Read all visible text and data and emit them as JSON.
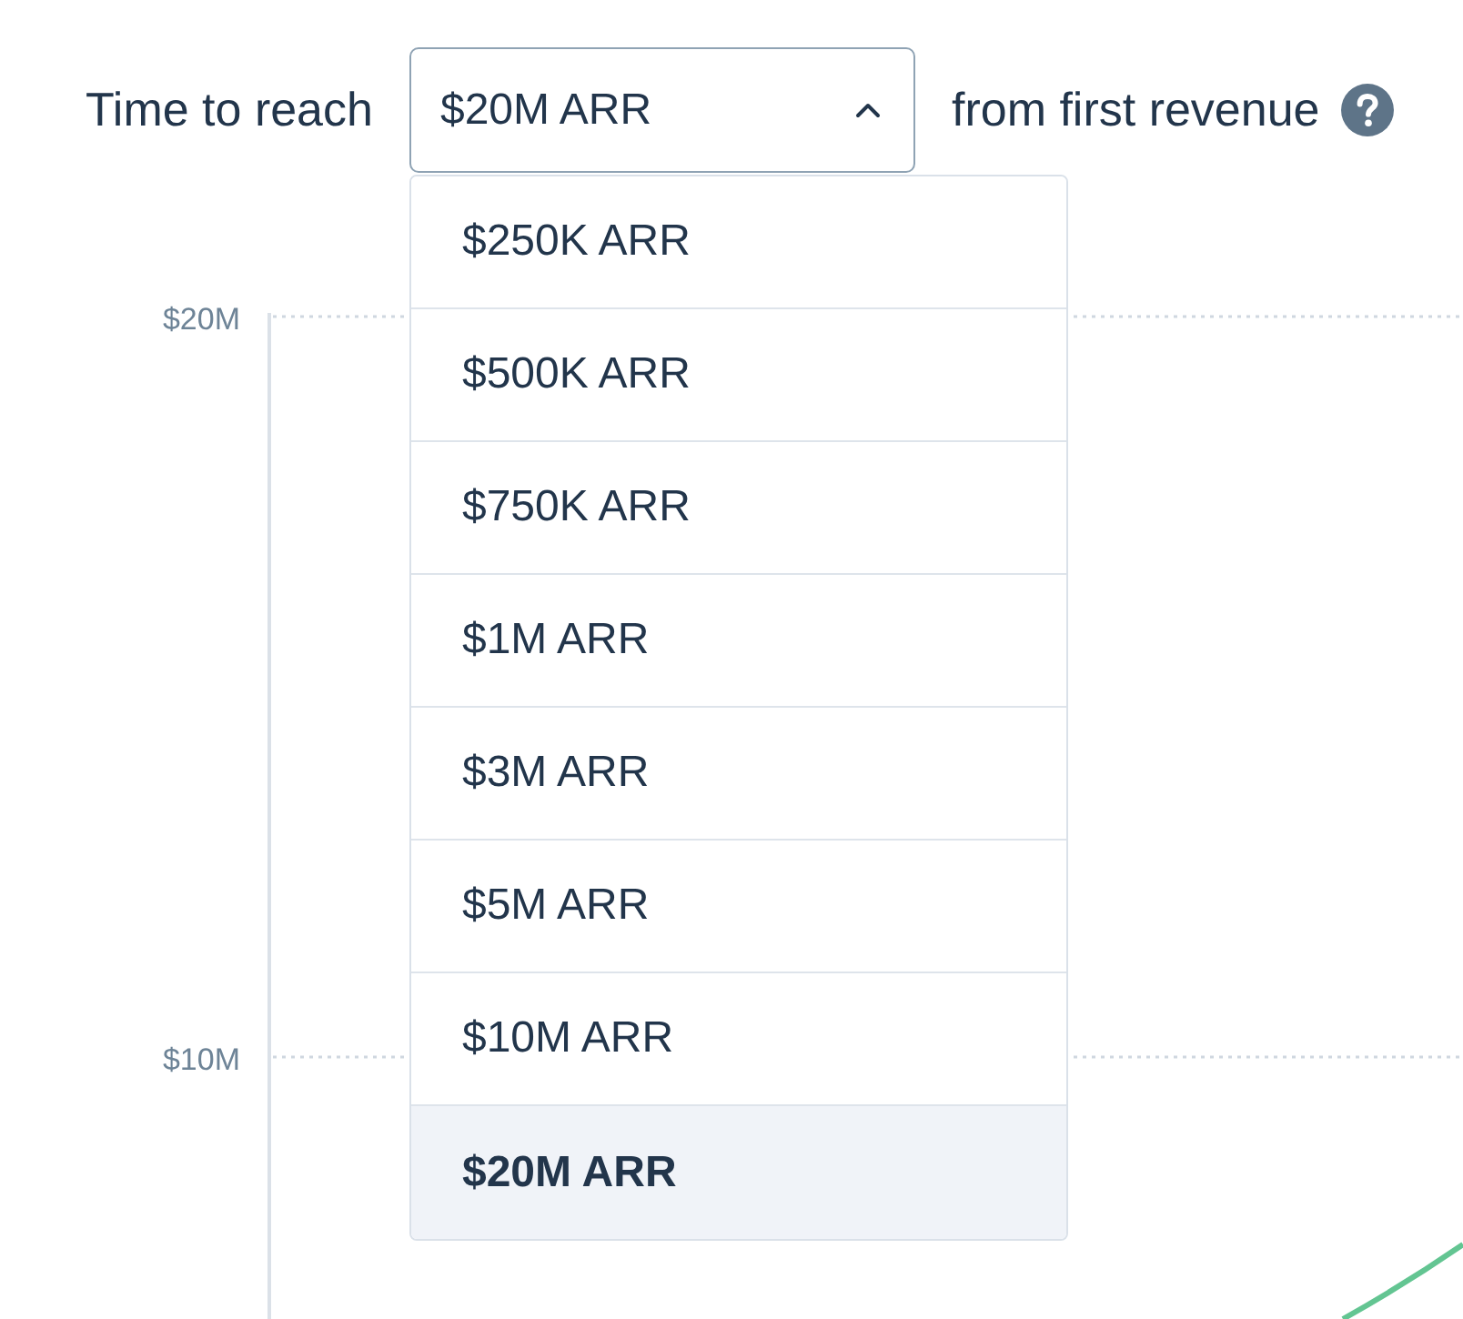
{
  "filter": {
    "prefix": "Time to reach",
    "select": {
      "value": "$20M ARR",
      "expanded": true,
      "options": [
        {
          "label": "$250K ARR",
          "selected": false
        },
        {
          "label": "$500K ARR",
          "selected": false
        },
        {
          "label": "$750K ARR",
          "selected": false
        },
        {
          "label": "$1M ARR",
          "selected": false
        },
        {
          "label": "$3M ARR",
          "selected": false
        },
        {
          "label": "$5M ARR",
          "selected": false
        },
        {
          "label": "$10M ARR",
          "selected": false
        },
        {
          "label": "$20M ARR",
          "selected": true
        }
      ]
    },
    "suffix": "from first revenue"
  },
  "chart": {
    "y_tick_labels": [
      "$20M",
      "$10M"
    ]
  }
}
